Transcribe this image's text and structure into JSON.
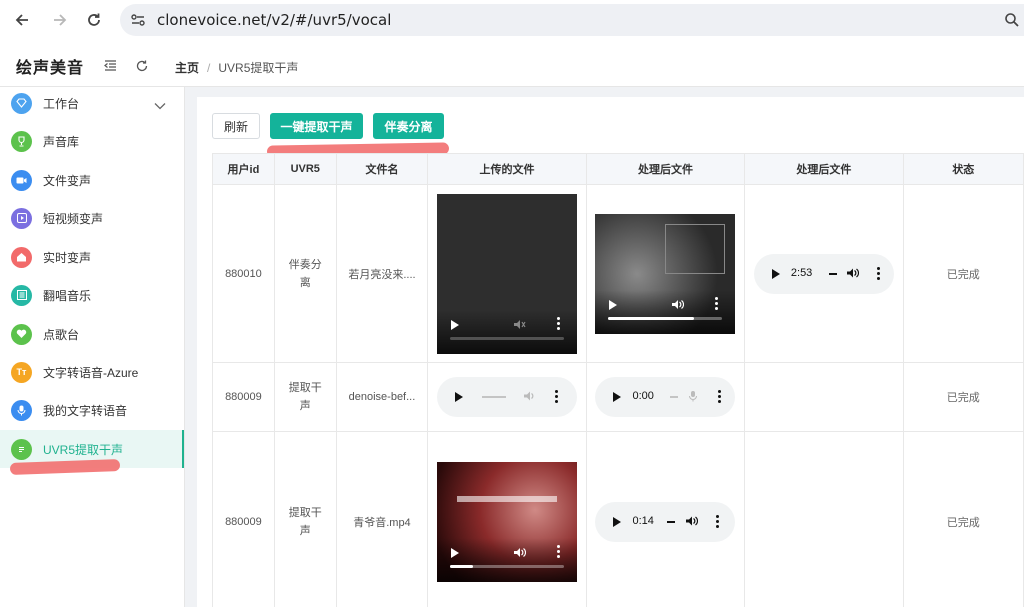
{
  "browser": {
    "url": "clonevoice.net/v2/#/uvr5/vocal"
  },
  "header": {
    "app_title": "绘声美音",
    "breadcrumb_home": "主页",
    "breadcrumb_sep": "/",
    "breadcrumb_current": "UVR5提取干声"
  },
  "sidebar": {
    "items": [
      {
        "label": "工作台",
        "icon": "diamond-icon",
        "color": "#4da3ef"
      },
      {
        "label": "声音库",
        "icon": "trophy-icon",
        "color": "#5cc24c"
      },
      {
        "label": "文件变声",
        "icon": "video-icon",
        "color": "#3b8df0"
      },
      {
        "label": "短视频变声",
        "icon": "play-square-icon",
        "color": "#7b6fe0"
      },
      {
        "label": "实时变声",
        "icon": "home-icon",
        "color": "#f26a6a"
      },
      {
        "label": "翻唱音乐",
        "icon": "list-icon",
        "color": "#26b8a5"
      },
      {
        "label": "点歌台",
        "icon": "heart-icon",
        "color": "#5cc24c"
      },
      {
        "label": "文字转语音-Azure",
        "icon": "text-icon",
        "color": "#f5a623"
      },
      {
        "label": "我的文字转语音",
        "icon": "mic-icon",
        "color": "#3b8df0"
      },
      {
        "label": "UVR5提取干声",
        "icon": "doc-icon",
        "color": "#5cc24c"
      }
    ]
  },
  "toolbar": {
    "refresh_label": "刷新",
    "extract_label": "一键提取干声",
    "separate_label": "伴奏分离"
  },
  "table": {
    "headers": [
      "用户id",
      "UVR5",
      "文件名",
      "上传的文件",
      "处理后文件",
      "处理后文件",
      "状态"
    ],
    "rows": [
      {
        "user_id": "880010",
        "uvr5": "伴奏分离",
        "filename": "若月亮没来....",
        "status": "已完成",
        "audio_time": "2:53",
        "processed_progress": 0.75
      },
      {
        "user_id": "880009",
        "uvr5": "提取干声",
        "filename": "denoise-bef...",
        "status": "已完成",
        "audio_time": "0:00"
      },
      {
        "user_id": "880009",
        "uvr5": "提取干声",
        "filename": "青爷音.mp4",
        "status": "已完成",
        "audio_time": "0:14",
        "uploaded_progress": 0.2
      }
    ]
  },
  "colors": {
    "primary": "#14b39a",
    "active_text": "#20b28f",
    "annotation": "#f26f6f"
  }
}
